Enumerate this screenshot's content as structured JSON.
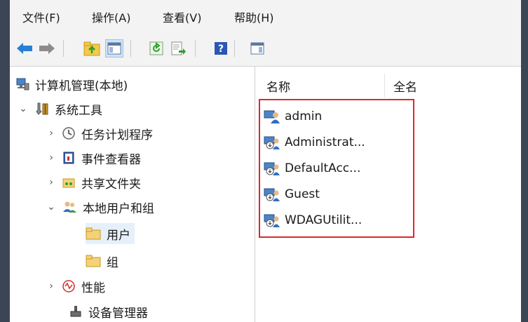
{
  "menubar": {
    "items": [
      "文件(F)",
      "操作(A)",
      "查看(V)",
      "帮助(H)"
    ]
  },
  "toolbar": {
    "buttons": [
      "back-arrow-icon",
      "forward-arrow-icon",
      "up-folder-icon",
      "show-hide-tree-icon",
      "refresh-icon",
      "export-list-icon",
      "help-icon",
      "action-pane-icon"
    ]
  },
  "tree": {
    "root": "计算机管理(本地)",
    "system_tools": "系统工具",
    "task_scheduler": "任务计划程序",
    "event_viewer": "事件查看器",
    "shared_folders": "共享文件夹",
    "local_users_groups": "本地用户和组",
    "users": "用户",
    "groups": "组",
    "performance": "性能",
    "device_manager": "设备管理器"
  },
  "list": {
    "columns": [
      "名称",
      "全名"
    ],
    "users": [
      "admin",
      "Administrat...",
      "DefaultAcc...",
      "Guest",
      "WDAGUtilit..."
    ]
  },
  "colors": {
    "highlight": "#d9292e",
    "window_frame": "#3c4556",
    "folder": "#f3d27a"
  }
}
